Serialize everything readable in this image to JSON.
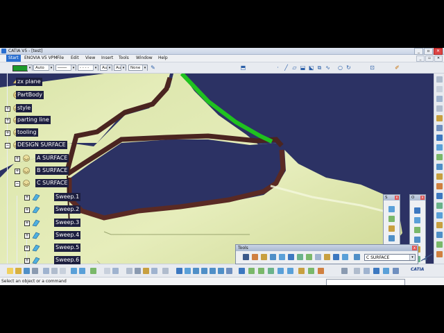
{
  "window": {
    "title": "CATIA V5 - [test]",
    "minimize": "_",
    "restore": "▫",
    "close": "✕"
  },
  "menu": {
    "items": [
      "Start",
      "ENOVIA V5 VPM",
      "File",
      "Edit",
      "View",
      "Insert",
      "Tools",
      "Window",
      "Help"
    ]
  },
  "properties": {
    "color": "#1c9a2a",
    "fill": "Auto",
    "layer": "Aut",
    "layer2": "Aut",
    "none": "None"
  },
  "tree": {
    "items": [
      {
        "label": "zx plane",
        "toggle": ""
      },
      {
        "label": "PartBody",
        "toggle": ""
      },
      {
        "label": "style",
        "toggle": "+"
      },
      {
        "label": "parting line",
        "toggle": "+"
      },
      {
        "label": "tooling",
        "toggle": "+"
      },
      {
        "label": "DESIGN SURFACE",
        "toggle": "−"
      },
      {
        "label": "A SURFACE",
        "toggle": "+"
      },
      {
        "label": "B SURFACE",
        "toggle": "+"
      },
      {
        "label": "C SURFACE",
        "toggle": "−"
      },
      {
        "label": "Sweep.1",
        "toggle": "+"
      },
      {
        "label": "Sweep.2",
        "toggle": "+"
      },
      {
        "label": "Sweep.3",
        "toggle": "+"
      },
      {
        "label": "Sweep.4",
        "toggle": "+"
      },
      {
        "label": "Sweep.5",
        "toggle": "+"
      },
      {
        "label": "Sweep.6",
        "toggle": "+"
      }
    ]
  },
  "floating": {
    "s_title": "S",
    "o_title": "O",
    "close": "x"
  },
  "tools": {
    "title": "Tools",
    "close": "x",
    "selector_value": "C SURFACE"
  },
  "status": {
    "message": "Select an object or a command"
  },
  "brand": "CATIA"
}
